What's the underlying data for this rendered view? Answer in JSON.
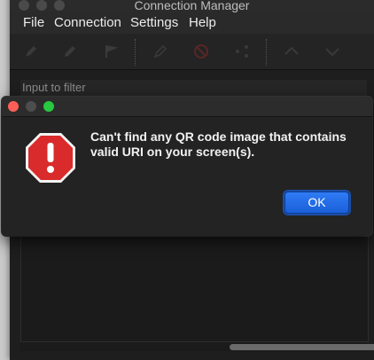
{
  "main_window": {
    "title": "Connection Manager",
    "menu": [
      {
        "label": "File"
      },
      {
        "label": "Connection"
      },
      {
        "label": "Settings"
      },
      {
        "label": "Help"
      }
    ],
    "toolbar_icons": [
      "pencil-icon",
      "pen-icon",
      "flag-icon",
      "edit-icon",
      "no-entry-icon",
      "share-icon",
      "chevron-up-icon",
      "chevron-down-icon"
    ],
    "filter_placeholder": "Input to filter"
  },
  "alert": {
    "message": "Can't find any QR code image that contains valid URI on your screen(s).",
    "ok_label": "OK",
    "icon": "stop-sign-exclamation-icon",
    "colors": {
      "close": "#ff5f57",
      "minimize": "#4d4d4d",
      "zoom": "#28c840",
      "stop_sign": "#d92b2b",
      "ok_button": "#2a73f0"
    }
  }
}
